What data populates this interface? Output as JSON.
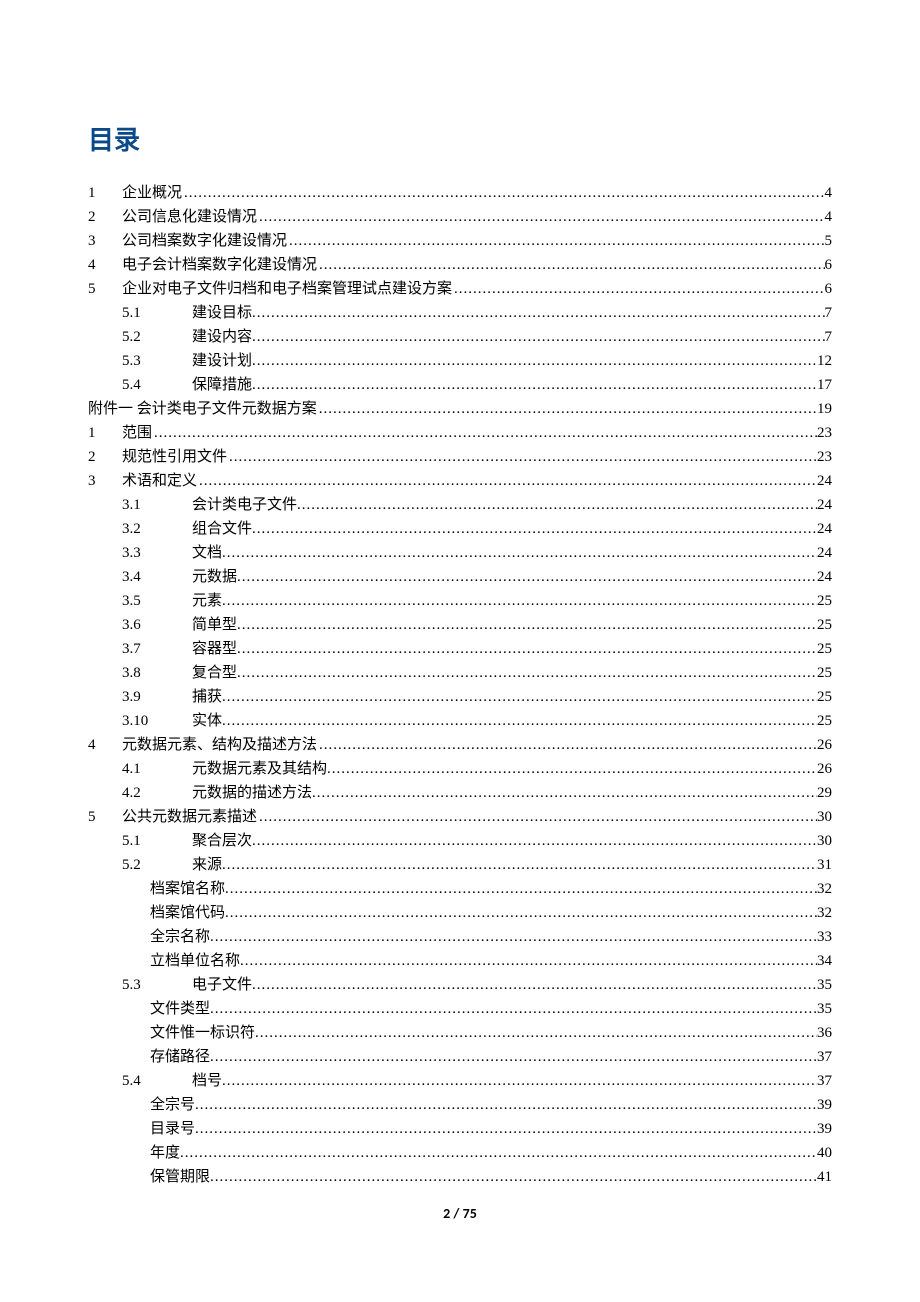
{
  "title": "目录",
  "footer": "2 / 75",
  "entries": [
    {
      "level": 0,
      "num": "1",
      "sub": "",
      "title": "企业概况",
      "page": "4"
    },
    {
      "level": 0,
      "num": "2",
      "sub": "",
      "title": "公司信息化建设情况",
      "page": "4"
    },
    {
      "level": 0,
      "num": "3",
      "sub": "",
      "title": "公司档案数字化建设情况",
      "page": "5"
    },
    {
      "level": 0,
      "num": "4",
      "sub": "",
      "title": "电子会计档案数字化建设情况",
      "page": "6"
    },
    {
      "level": 0,
      "num": "5",
      "sub": "",
      "title": "企业对电子文件归档和电子档案管理试点建设方案",
      "page": "6"
    },
    {
      "level": 1,
      "num": "",
      "sub": "5.1",
      "title": "建设目标",
      "page": "7"
    },
    {
      "level": 1,
      "num": "",
      "sub": "5.2",
      "title": "建设内容",
      "page": "7"
    },
    {
      "level": 1,
      "num": "",
      "sub": "5.3",
      "title": "建设计划",
      "page": "12"
    },
    {
      "level": 1,
      "num": "",
      "sub": "5.4",
      "title": "保障措施",
      "page": "17"
    },
    {
      "level": 0,
      "num": "",
      "sub": "",
      "title": "附件一 会计类电子文件元数据方案",
      "page": "19",
      "noNumCol": true
    },
    {
      "level": 0,
      "num": "1",
      "sub": "",
      "title": "范围",
      "page": "23"
    },
    {
      "level": 0,
      "num": "2",
      "sub": "",
      "title": "规范性引用文件",
      "page": "23"
    },
    {
      "level": 0,
      "num": "3",
      "sub": "",
      "title": "术语和定义",
      "page": "24"
    },
    {
      "level": 1,
      "num": "",
      "sub": "3.1",
      "title": "会计类电子文件",
      "page": "24"
    },
    {
      "level": 1,
      "num": "",
      "sub": "3.2",
      "title": "组合文件",
      "page": "24"
    },
    {
      "level": 1,
      "num": "",
      "sub": "3.3",
      "title": "文档",
      "page": "24"
    },
    {
      "level": 1,
      "num": "",
      "sub": "3.4",
      "title": "元数据",
      "page": "24"
    },
    {
      "level": 1,
      "num": "",
      "sub": "3.5",
      "title": "元素",
      "page": "25"
    },
    {
      "level": 1,
      "num": "",
      "sub": "3.6",
      "title": "简单型",
      "page": "25"
    },
    {
      "level": 1,
      "num": "",
      "sub": "3.7",
      "title": "容器型",
      "page": "25"
    },
    {
      "level": 1,
      "num": "",
      "sub": "3.8",
      "title": "复合型",
      "page": "25"
    },
    {
      "level": 1,
      "num": "",
      "sub": "3.9",
      "title": "捕获",
      "page": "25"
    },
    {
      "level": 1,
      "num": "",
      "sub": "3.10",
      "title": "实体",
      "page": "25"
    },
    {
      "level": 0,
      "num": "4",
      "sub": "",
      "title": "元数据元素、结构及描述方法",
      "page": "26"
    },
    {
      "level": 1,
      "num": "",
      "sub": "4.1",
      "title": "元数据元素及其结构",
      "page": "26"
    },
    {
      "level": 1,
      "num": "",
      "sub": "4.2",
      "title": "元数据的描述方法",
      "page": "29"
    },
    {
      "level": 0,
      "num": "5",
      "sub": "",
      "title": "公共元数据元素描述",
      "page": "30"
    },
    {
      "level": 1,
      "num": "",
      "sub": "5.1",
      "title": "聚合层次",
      "page": "30"
    },
    {
      "level": 1,
      "num": "",
      "sub": "5.2",
      "title": "来源",
      "page": "31"
    },
    {
      "level": 2,
      "num": "",
      "sub": "",
      "title": "档案馆名称",
      "page": "32"
    },
    {
      "level": 2,
      "num": "",
      "sub": "",
      "title": "档案馆代码",
      "page": "32"
    },
    {
      "level": 2,
      "num": "",
      "sub": "",
      "title": "全宗名称",
      "page": "33"
    },
    {
      "level": 2,
      "num": "",
      "sub": "",
      "title": "立档单位名称",
      "page": "34"
    },
    {
      "level": 1,
      "num": "",
      "sub": "5.3",
      "title": "电子文件",
      "page": "35"
    },
    {
      "level": 2,
      "num": "",
      "sub": "",
      "title": "文件类型",
      "page": "35"
    },
    {
      "level": 2,
      "num": "",
      "sub": "",
      "title": "文件惟一标识符",
      "page": "36"
    },
    {
      "level": 2,
      "num": "",
      "sub": "",
      "title": "存储路径",
      "page": "37"
    },
    {
      "level": 1,
      "num": "",
      "sub": "5.4",
      "title": "档号",
      "page": "37"
    },
    {
      "level": 2,
      "num": "",
      "sub": "",
      "title": "全宗号",
      "page": "39"
    },
    {
      "level": 2,
      "num": "",
      "sub": "",
      "title": "目录号",
      "page": "39"
    },
    {
      "level": 2,
      "num": "",
      "sub": "",
      "title": "年度",
      "page": "40"
    },
    {
      "level": 2,
      "num": "",
      "sub": "",
      "title": "保管期限",
      "page": "41"
    }
  ]
}
